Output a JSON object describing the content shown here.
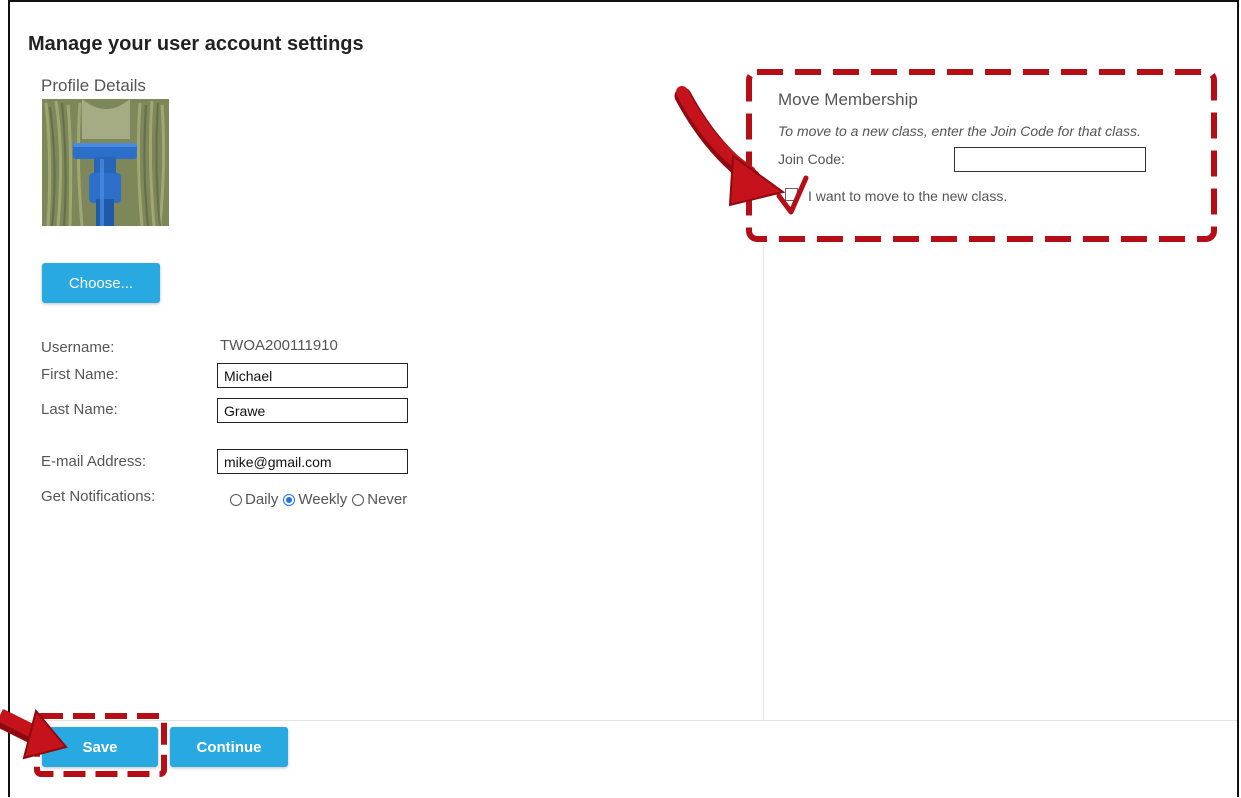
{
  "page": {
    "title": "Manage your user account settings",
    "profile_section_title": "Profile Details"
  },
  "profile": {
    "choose_label": "Choose...",
    "username_label": "Username:",
    "username_value": "TWOA200111910",
    "first_name_label": "First Name:",
    "first_name_value": "Michael",
    "last_name_label": "Last Name:",
    "last_name_value": "Grawe",
    "email_label": "E-mail Address:",
    "email_value": "mike@gmail.com",
    "notifications_label": "Get Notifications:",
    "notification_options": [
      "Daily",
      "Weekly",
      "Never"
    ],
    "notification_selected": "Weekly"
  },
  "move_membership": {
    "title": "Move Membership",
    "hint": "To move to a new class, enter the Join Code for that class.",
    "join_code_label": "Join Code:",
    "join_code_value": "",
    "confirm_label": "I want to move to the new class."
  },
  "footer": {
    "save_label": "Save",
    "continue_label": "Continue"
  },
  "colors": {
    "button": "#29a9e1",
    "annotation": "#b50e16",
    "radio_selected": "#1a73e8"
  }
}
